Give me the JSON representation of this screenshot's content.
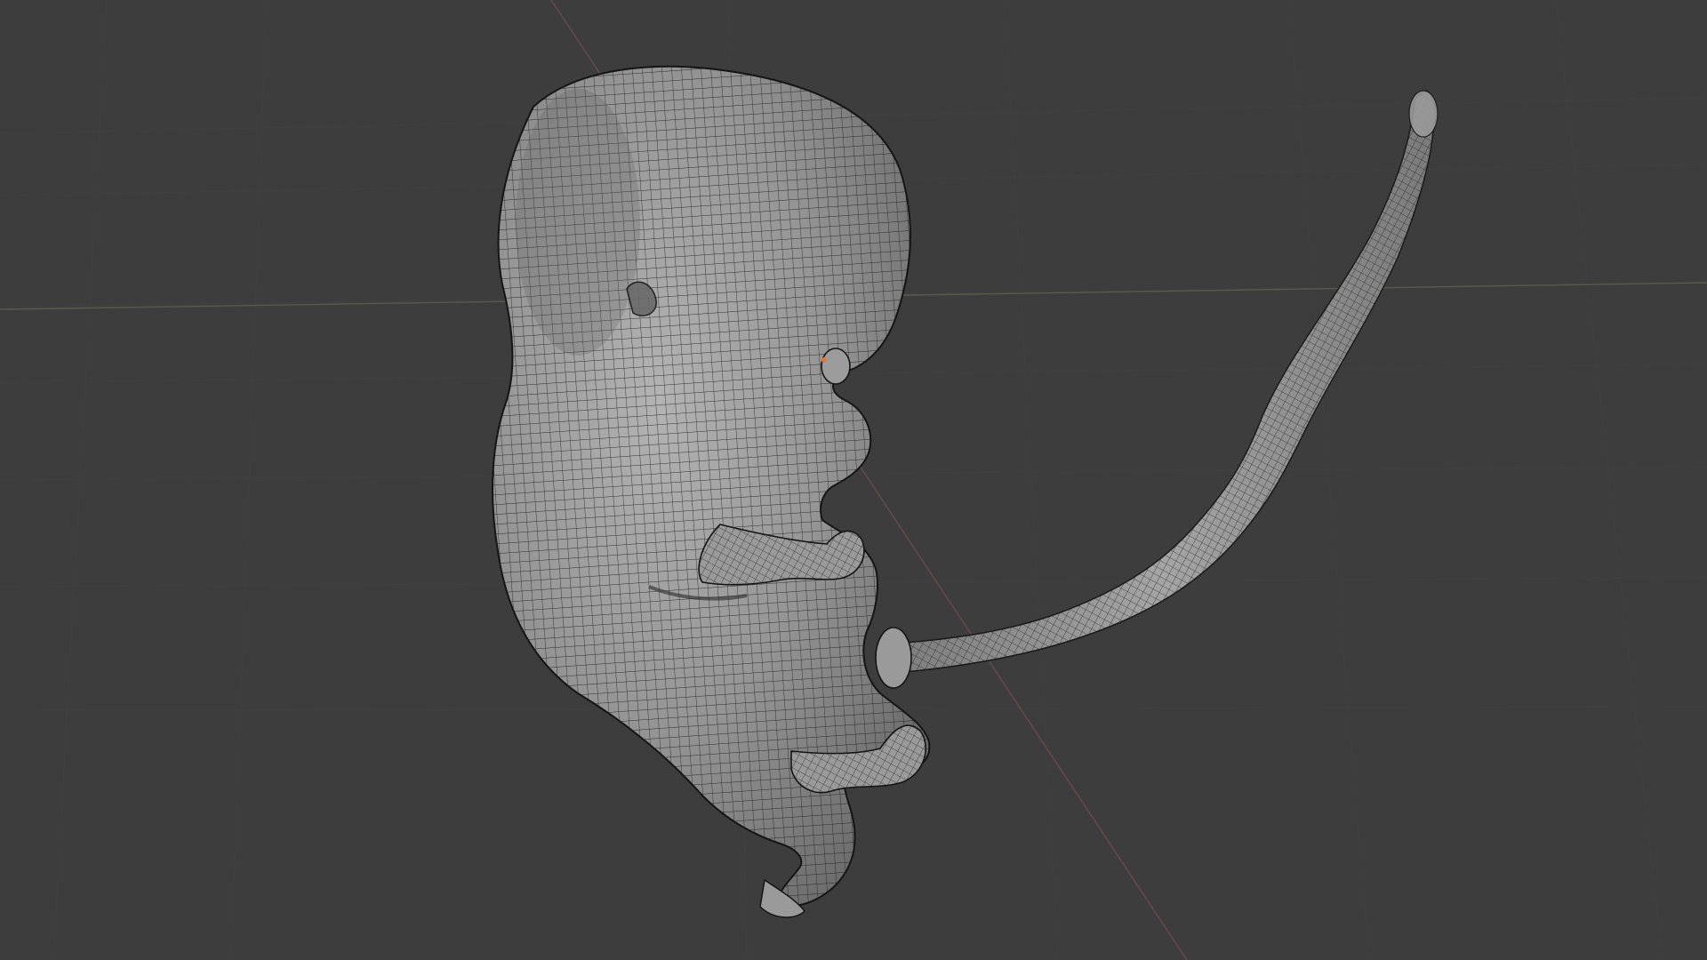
{
  "viewport": {
    "background_color": "#3d3d3d",
    "grid_color": "#454545",
    "axis_x_color": "#5a5a4c",
    "axis_y_color": "#6b4a4a",
    "mesh_base_color": "#8e8e8e",
    "mesh_wire_color": "#1c1c1c",
    "origin_color": "#e07a3a",
    "overlays": {
      "grid_floor": true,
      "wireframe": true,
      "shading": "solid"
    }
  },
  "objects": [
    {
      "name_icon": "mesh-object-icon",
      "selected": true
    }
  ]
}
